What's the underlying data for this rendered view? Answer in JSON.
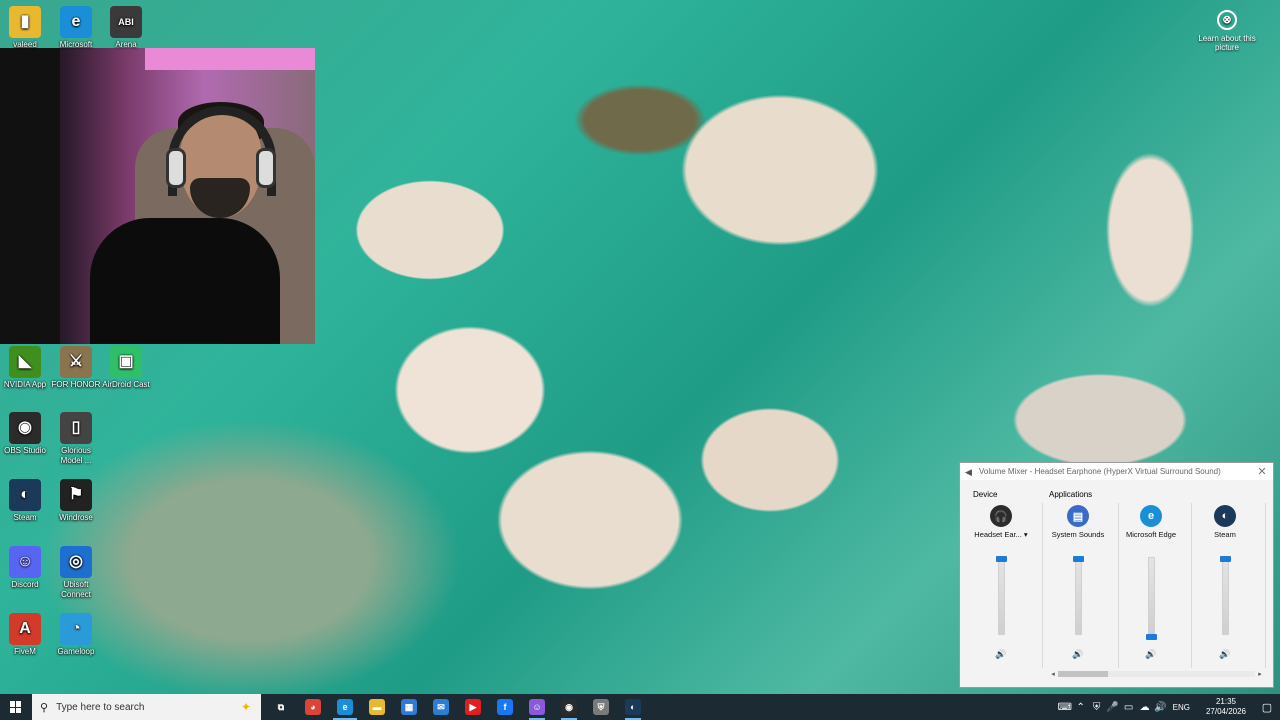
{
  "desktop_icons": [
    {
      "label": "valeed",
      "icon": "folder-icon",
      "color": "#e8b830",
      "glyph": "▮"
    },
    {
      "label": "Microsoft",
      "icon": "edge-icon",
      "color": "#1a8fd8",
      "glyph": "e"
    },
    {
      "label": "Arena",
      "icon": "arena-game-icon",
      "color": "#3a3a3a",
      "glyph": "ABI"
    },
    {
      "label": "NVIDIA App",
      "icon": "nvidia-icon",
      "color": "#3f8f1f",
      "glyph": "◣"
    },
    {
      "label": "FOR HONOR",
      "icon": "for-honor-icon",
      "color": "#8a7450",
      "glyph": "⚔"
    },
    {
      "label": "AirDroid Cast",
      "icon": "airdroid-cast-icon",
      "color": "#2fbf6a",
      "glyph": "▣"
    },
    {
      "label": "OBS Studio",
      "icon": "obs-icon",
      "color": "#2b2b2b",
      "glyph": "◉"
    },
    {
      "label": "Glorious Model ...",
      "icon": "glorious-mouse-icon",
      "color": "#444444",
      "glyph": "▯"
    },
    {
      "label": "Steam",
      "icon": "steam-icon",
      "color": "#1b3a5a",
      "glyph": "◐"
    },
    {
      "label": "Windrose",
      "icon": "windrose-icon",
      "color": "#222222",
      "glyph": "⚑"
    },
    {
      "label": "Discord",
      "icon": "discord-icon",
      "color": "#5865f2",
      "glyph": "☺"
    },
    {
      "label": "Ubisoft Connect",
      "icon": "ubisoft-icon",
      "color": "#1f6fd1",
      "glyph": "◎"
    },
    {
      "label": "FiveM",
      "icon": "fivem-icon",
      "color": "#d23a2a",
      "glyph": "A"
    },
    {
      "label": "Gameloop",
      "icon": "gameloop-icon",
      "color": "#2a9ad8",
      "glyph": "◔"
    }
  ],
  "learn": {
    "label": "Learn about this picture",
    "icon": "camera-info-icon",
    "glyph": "⊗"
  },
  "mixer": {
    "title": "Volume Mixer - Headset Earphone (HyperX Virtual Surround Sound)",
    "close_glyph": "✕",
    "device_header": "Device",
    "apps_header": "Applications",
    "columns": [
      {
        "name": "Headset Ear...",
        "dropdown": "▾",
        "icon": "headset-icon",
        "color": "#2c2c2c",
        "glyph": "🎧",
        "level": 1.0
      },
      {
        "name": "System Sounds",
        "dropdown": "",
        "icon": "system-sounds-icon",
        "color": "#3b6bc9",
        "glyph": "▤",
        "level": 1.0
      },
      {
        "name": "Microsoft Edge",
        "dropdown": "",
        "icon": "edge-icon",
        "color": "#1a8fd8",
        "glyph": "e",
        "level": 0.0
      },
      {
        "name": "Steam",
        "dropdown": "",
        "icon": "steam-icon",
        "color": "#1b3a5a",
        "glyph": "◐",
        "level": 1.0
      }
    ],
    "mute_glyph": "🔊",
    "scroll_left": "◂",
    "scroll_right": "▸"
  },
  "taskbar": {
    "search_placeholder": "Type here to search",
    "apps": [
      {
        "name": "task-view",
        "icon": "task-view-icon",
        "color": "#1c2a33",
        "glyph": "⧉",
        "state": ""
      },
      {
        "name": "chrome",
        "icon": "chrome-icon",
        "color": "#db4437",
        "glyph": "◕",
        "state": ""
      },
      {
        "name": "edge",
        "icon": "edge-icon",
        "color": "#1a8fd8",
        "glyph": "e",
        "state": "active"
      },
      {
        "name": "file-explorer",
        "icon": "folder-icon",
        "color": "#e8b830",
        "glyph": "▬",
        "state": ""
      },
      {
        "name": "store",
        "icon": "store-icon",
        "color": "#2e7bd6",
        "glyph": "▦",
        "state": ""
      },
      {
        "name": "mail",
        "icon": "mail-icon",
        "color": "#2a7fd4",
        "glyph": "✉",
        "state": ""
      },
      {
        "name": "youtube",
        "icon": "youtube-icon",
        "color": "#e02020",
        "glyph": "▶",
        "state": ""
      },
      {
        "name": "facebook",
        "icon": "facebook-icon",
        "color": "#1877f2",
        "glyph": "f",
        "state": ""
      },
      {
        "name": "discord-app",
        "icon": "discord-icon",
        "color": "#8a5ad8",
        "glyph": "☺",
        "state": "running"
      },
      {
        "name": "obs",
        "icon": "obs-icon",
        "color": "#2b2b2b",
        "glyph": "◉",
        "state": "running"
      },
      {
        "name": "shield",
        "icon": "shield-icon",
        "color": "#7a7a7a",
        "glyph": "⛨",
        "state": ""
      },
      {
        "name": "steam",
        "icon": "steam-icon",
        "color": "#1b3a5a",
        "glyph": "◐",
        "state": "running"
      }
    ],
    "tray": {
      "icons": [
        {
          "name": "keyboard-icon",
          "glyph": "⌨"
        },
        {
          "name": "tray-overflow-icon",
          "glyph": "⌃"
        },
        {
          "name": "shield-tray-icon",
          "glyph": "⛨"
        },
        {
          "name": "microphone-icon",
          "glyph": "🎤"
        },
        {
          "name": "network-icon",
          "glyph": "▭"
        },
        {
          "name": "cloud-icon",
          "glyph": "☁"
        },
        {
          "name": "volume-icon",
          "glyph": "🔊"
        }
      ],
      "language": "ENG",
      "time": "21:35",
      "date": "27/04/2026",
      "notification_glyph": "▢"
    }
  }
}
